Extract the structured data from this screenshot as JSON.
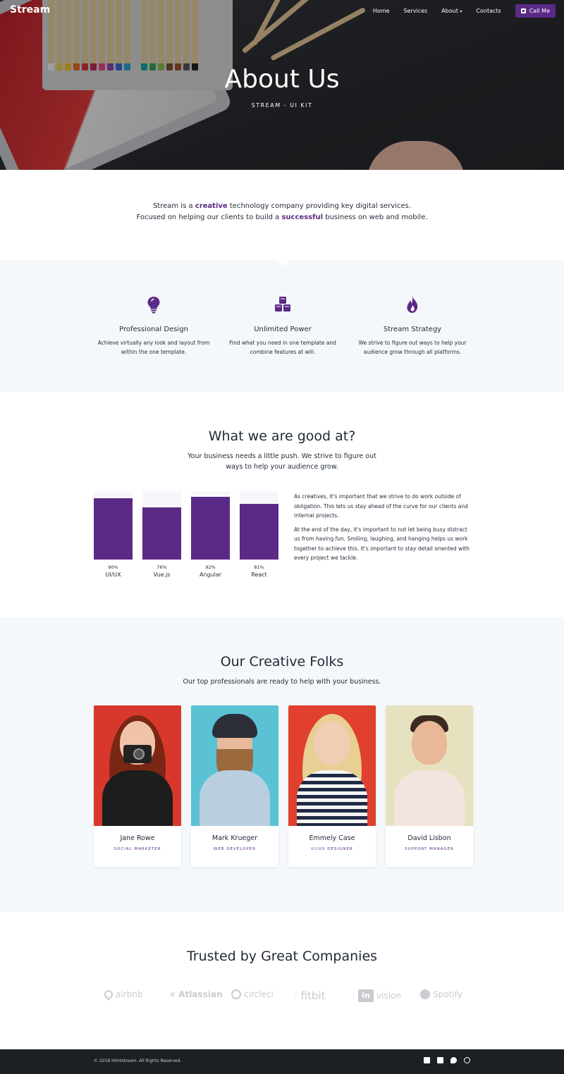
{
  "nav": {
    "brand": "Stream",
    "links": [
      "Home",
      "Services",
      "About",
      "Contacts"
    ],
    "about_caret": "▾",
    "call_label": "Call Me"
  },
  "hero": {
    "title": "About Us",
    "subtitle": "STREAM - UI KIT"
  },
  "intro": {
    "line1_a": "Stream is a ",
    "line1_highlight": "creative",
    "line1_b": " technology company providing key digital services.",
    "line2_a": "Focused on helping our clients to build a ",
    "line2_highlight": "successful",
    "line2_b": " business on web and mobile."
  },
  "features": [
    {
      "icon": "lightbulb-icon",
      "title": "Professional Design",
      "text_line1": "Achieve virtually any look and layout from",
      "text_line2": "within the one template."
    },
    {
      "icon": "cubes-icon",
      "title": "Unlimited Power",
      "text_line1": "Find what you need in one template and",
      "text_line2": "combine features at will."
    },
    {
      "icon": "fire-icon",
      "title": "Stream Strategy",
      "text_line1": "We strive to figure out ways to help your",
      "text_line2": "audience grow through all platforms."
    }
  ],
  "skills": {
    "title": "What we are good at?",
    "subtitle_line1": "Your business needs a little push. We strive to figure out",
    "subtitle_line2": "ways to help your audience grow.",
    "bars": [
      {
        "label": "UI/UX",
        "percent_text": "90%",
        "value": 0.9
      },
      {
        "label": "Vue.js",
        "percent_text": "76%",
        "value": 0.76
      },
      {
        "label": "Angular",
        "percent_text": "92%",
        "value": 0.92
      },
      {
        "label": "React",
        "percent_text": "81%",
        "value": 0.81
      }
    ],
    "paragraph1": "As creatives, it's important that we strive to do work outside of obligation. This lets us stay ahead of the curve for our clients and internal projects.",
    "paragraph2": "At the end of the day, it's important to not let being busy distract us from having fun. Smiling, laughing, and hanging helps us work together to achieve this. It's important to stay detail oriented with every project we tackle."
  },
  "team": {
    "title": "Our Creative Folks",
    "subtitle": "Our top professionals are ready to help with your business.",
    "members": [
      {
        "name": "Jane Rowe",
        "role": "SOCIAL MARKETER",
        "bg": "#d7382b"
      },
      {
        "name": "Mark Krueger",
        "role": "WEB DEVELOPER",
        "bg": "#5bc2d6"
      },
      {
        "name": "Emmely Case",
        "role": "UI/UX DESIGNER",
        "bg": "#e0402d"
      },
      {
        "name": "David Lisbon",
        "role": "SUPPORT MANAGER",
        "bg": "#e6e2bf"
      }
    ]
  },
  "companies": {
    "title": "Trusted by Great Companies",
    "logos": [
      "airbnb",
      "Atlassian",
      "circleci",
      "fitbit",
      "vision",
      "Spotify"
    ],
    "invision_prefix": "in"
  },
  "footer": {
    "copyright": "© 2018 Htmlstream. All Rights Reserved.",
    "socials": [
      "facebook-icon",
      "linkedin-icon",
      "twitter-icon",
      "dribbble-icon"
    ]
  },
  "colors": {
    "accent": "#5b2a86",
    "light_section": "#f5f8fb",
    "footer_bg": "#1c1f24"
  }
}
